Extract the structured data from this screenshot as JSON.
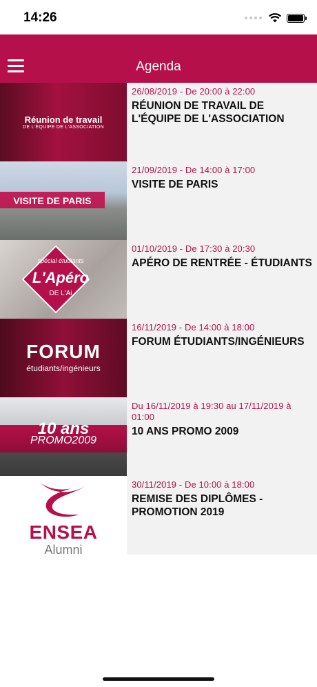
{
  "status": {
    "time": "14:26"
  },
  "header": {
    "title": "Agenda"
  },
  "events": [
    {
      "date": "26/08/2019 - De 20:00 à 22:00",
      "title": "RÉUNION DE TRAVAIL DE L'ÉQUIPE DE L'ASSOCIATION",
      "thumb_text": "Réunion de travail",
      "thumb_subtext": "DE L'ÉQUIPE DE L'ASSOCIATION"
    },
    {
      "date": "21/09/2019 - De 14:00 à 17:00",
      "title": "VISITE DE PARIS",
      "thumb_text": "VISITE DE PARIS"
    },
    {
      "date": "01/10/2019 - De 17:30 à 20:30",
      "title": "APÉRO DE RENTRÉE - ÉTUDIANTS",
      "thumb_small": "spécial étudiants",
      "thumb_text": "L'Apéro",
      "thumb_subtext": "DE L'Ai"
    },
    {
      "date": "16/11/2019 - De 14:00 à 18:00",
      "title": "FORUM ÉTUDIANTS/INGÉNIEURS",
      "thumb_text": "FORUM",
      "thumb_subtext": "étudiants/ingénieurs"
    },
    {
      "date": "Du 16/11/2019 à 19:30 au 17/11/2019 à 01:00",
      "title": "10 ANS PROMO 2009",
      "thumb_text": "10 ans",
      "thumb_subtext": "PROMO2009"
    },
    {
      "date": "30/11/2019 - De 10:00 à 18:00",
      "title": "REMISE DES DIPLÔMES - PROMOTION 2019",
      "thumb_text": "ENSEA",
      "thumb_subtext": "Alumni"
    }
  ]
}
